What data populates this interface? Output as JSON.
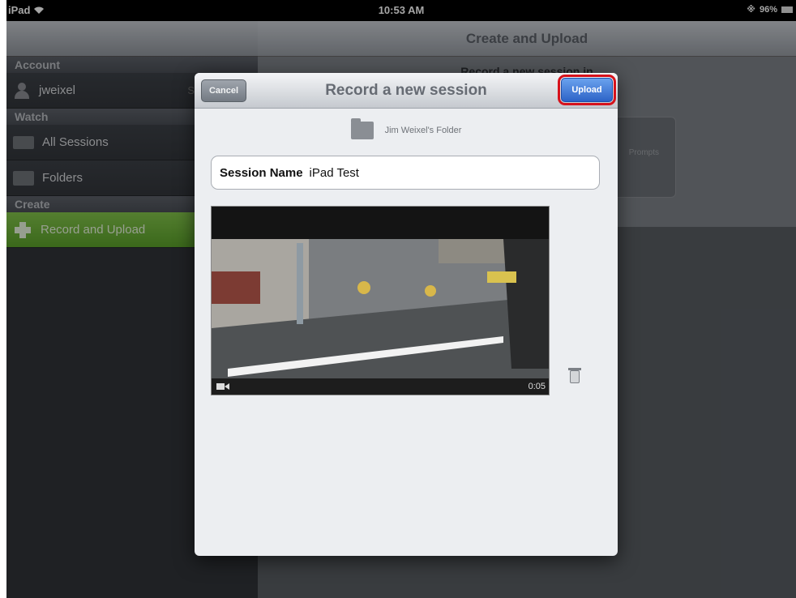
{
  "status_bar": {
    "device": "iPad",
    "time": "10:53 AM",
    "battery": "96%"
  },
  "sidebar": {
    "sections": [
      {
        "header": "Account",
        "items": [
          {
            "label": "jweixel",
            "icon": "user-icon",
            "trail": "S"
          }
        ]
      },
      {
        "header": "Watch",
        "items": [
          {
            "label": "All Sessions",
            "icon": "film-icon"
          },
          {
            "label": "Folders",
            "icon": "folder-icon"
          }
        ]
      },
      {
        "header": "Create",
        "items": [
          {
            "label": "Record and Upload",
            "icon": "plus-icon",
            "active": true
          }
        ]
      }
    ]
  },
  "main": {
    "title": "Create and Upload",
    "hint": "Record a new session in",
    "card_text": "Prompts"
  },
  "modal": {
    "title": "Record a new session",
    "cancel_label": "Cancel",
    "upload_label": "Upload",
    "folder_name": "Jim Weixel's Folder",
    "session_name_label": "Session Name",
    "session_name_value": "iPad Test",
    "video_duration": "0:05"
  },
  "colors": {
    "highlight_outline": "#d6121c",
    "active_item": "#6cb33a",
    "upload_button": "#3a74d8"
  }
}
